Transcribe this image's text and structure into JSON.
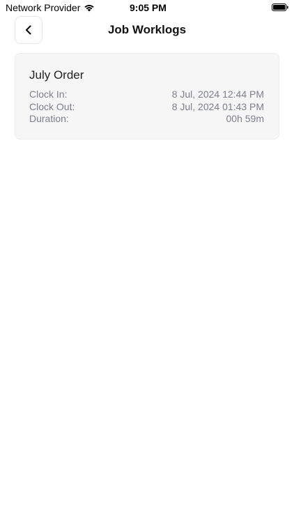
{
  "status_bar": {
    "carrier": "Network Provider",
    "time": "9:05 PM",
    "icons": [
      "wifi-icon",
      "battery-icon"
    ]
  },
  "header": {
    "title": "Job Worklogs",
    "back_icon": "chevron-left-icon"
  },
  "worklogs": [
    {
      "title": "July Order",
      "clock_in_label": "Clock In:",
      "clock_in_value": "8 Jul, 2024 12:44 PM",
      "clock_out_label": "Clock Out:",
      "clock_out_value": "8 Jul, 2024 01:43 PM",
      "duration_label": "Duration:",
      "duration_value": "00h 59m"
    }
  ],
  "colors": {
    "card_background": "#f6f6f7",
    "secondary_text": "#7d7e93"
  }
}
